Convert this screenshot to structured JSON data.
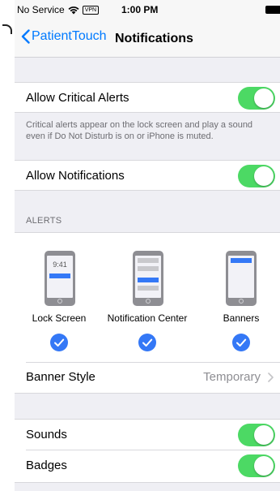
{
  "status_bar": {
    "carrier": "No Service",
    "vpn": "VPN",
    "time": "1:00 PM",
    "icons": [
      "wifi-icon",
      "battery-icon"
    ]
  },
  "nav": {
    "back_label": "PatientTouch",
    "title": "Notifications"
  },
  "critical_alerts": {
    "label": "Allow Critical Alerts",
    "enabled": true,
    "footer": "Critical alerts appear on the lock screen and play a sound even if Do Not Disturb is on or iPhone is muted."
  },
  "notifications": {
    "label": "Allow Notifications",
    "enabled": true
  },
  "alerts": {
    "header": "ALERTS",
    "lock_screen_time": "9:41",
    "options": [
      {
        "label": "Lock Screen",
        "selected": true
      },
      {
        "label": "Notification Center",
        "selected": true
      },
      {
        "label": "Banners",
        "selected": true
      }
    ]
  },
  "banner_style": {
    "label": "Banner Style",
    "value": "Temporary"
  },
  "sounds": {
    "label": "Sounds",
    "enabled": true
  },
  "badges": {
    "label": "Badges",
    "enabled": true
  },
  "colors": {
    "accent": "#007aff",
    "toggle_on": "#4cd964",
    "selection": "#3478f6",
    "background": "#efeff4"
  }
}
